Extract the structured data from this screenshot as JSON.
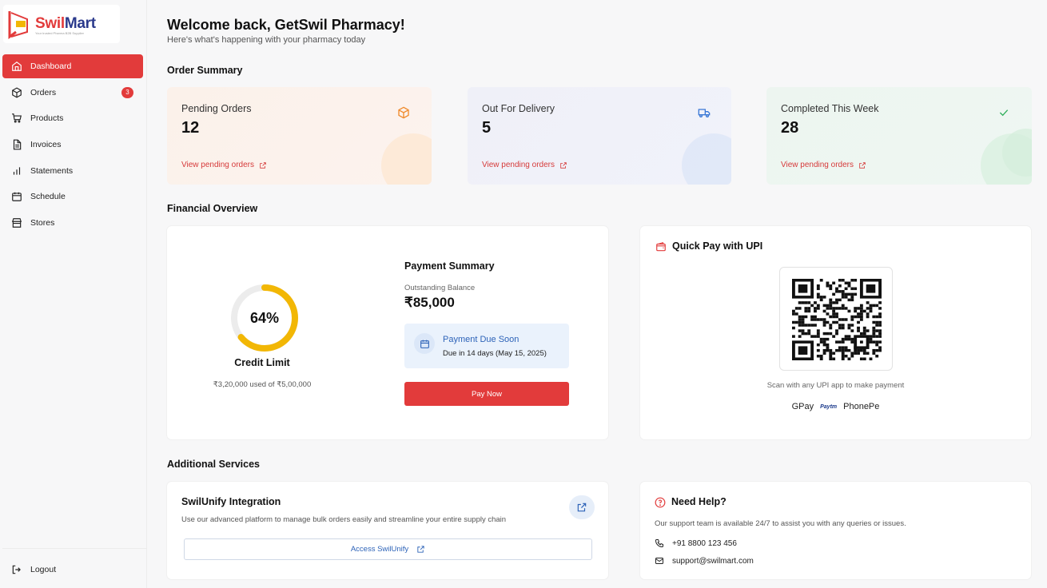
{
  "brand": {
    "name_part1": "Swil",
    "name_part2": "Mart",
    "tagline": "Your trusted Pharma B2B Supplier"
  },
  "sidebar": {
    "items": [
      {
        "label": "Dashboard",
        "icon": "home-icon",
        "active": true
      },
      {
        "label": "Orders",
        "icon": "box-icon",
        "badge": "3"
      },
      {
        "label": "Products",
        "icon": "cart-icon"
      },
      {
        "label": "Invoices",
        "icon": "document-icon"
      },
      {
        "label": "Statements",
        "icon": "bar-chart-icon"
      },
      {
        "label": "Schedule",
        "icon": "calendar-icon"
      },
      {
        "label": "Stores",
        "icon": "store-icon"
      }
    ],
    "logout_label": "Logout"
  },
  "header": {
    "welcome": "Welcome back, GetSwil Pharmacy!",
    "subtitle": "Here's what's happening with your pharmacy today"
  },
  "order_summary": {
    "title": "Order Summary",
    "cards": [
      {
        "label": "Pending Orders",
        "value": "12",
        "link": "View pending orders",
        "icon": "package-icon",
        "accent": "#f08a2c"
      },
      {
        "label": "Out For Delivery",
        "value": "5",
        "link": "View pending orders",
        "icon": "truck-icon",
        "accent": "#3a78d6"
      },
      {
        "label": "Completed This Week",
        "value": "28",
        "link": "View pending orders",
        "icon": "check-icon",
        "accent": "#2fae5b"
      }
    ]
  },
  "financial": {
    "title": "Financial Overview",
    "credit": {
      "percent_label": "64%",
      "percent": 64,
      "label": "Credit Limit",
      "used": "₹3,20,000 used of ₹5,00,000"
    },
    "payment": {
      "title": "Payment Summary",
      "outstanding_label": "Outstanding Balance",
      "outstanding_value": "₹85,000",
      "due_title": "Payment Due Soon",
      "due_text": "Due in 14 days (May 15, 2025)",
      "pay_button": "Pay Now"
    },
    "quick_pay": {
      "title": "Quick Pay with UPI",
      "hint": "Scan with any UPI app to make payment",
      "apps": [
        "GPay",
        "Paytm",
        "PhonePe"
      ]
    }
  },
  "additional": {
    "title": "Additional Services",
    "swilunify": {
      "title": "SwilUnify Integration",
      "desc": "Use our advanced platform to manage bulk orders easily and streamline your entire supply chain",
      "button": "Access SwilUnify"
    },
    "help": {
      "title": "Need Help?",
      "desc": "Our support team is available 24/7 to assist you with any queries or issues.",
      "phone": "+91 8800 123 456",
      "email": "support@swilmart.com"
    }
  },
  "colors": {
    "accent_red": "#e23b3b",
    "link_blue": "#2d63b8",
    "donut_yellow": "#f2b705"
  }
}
